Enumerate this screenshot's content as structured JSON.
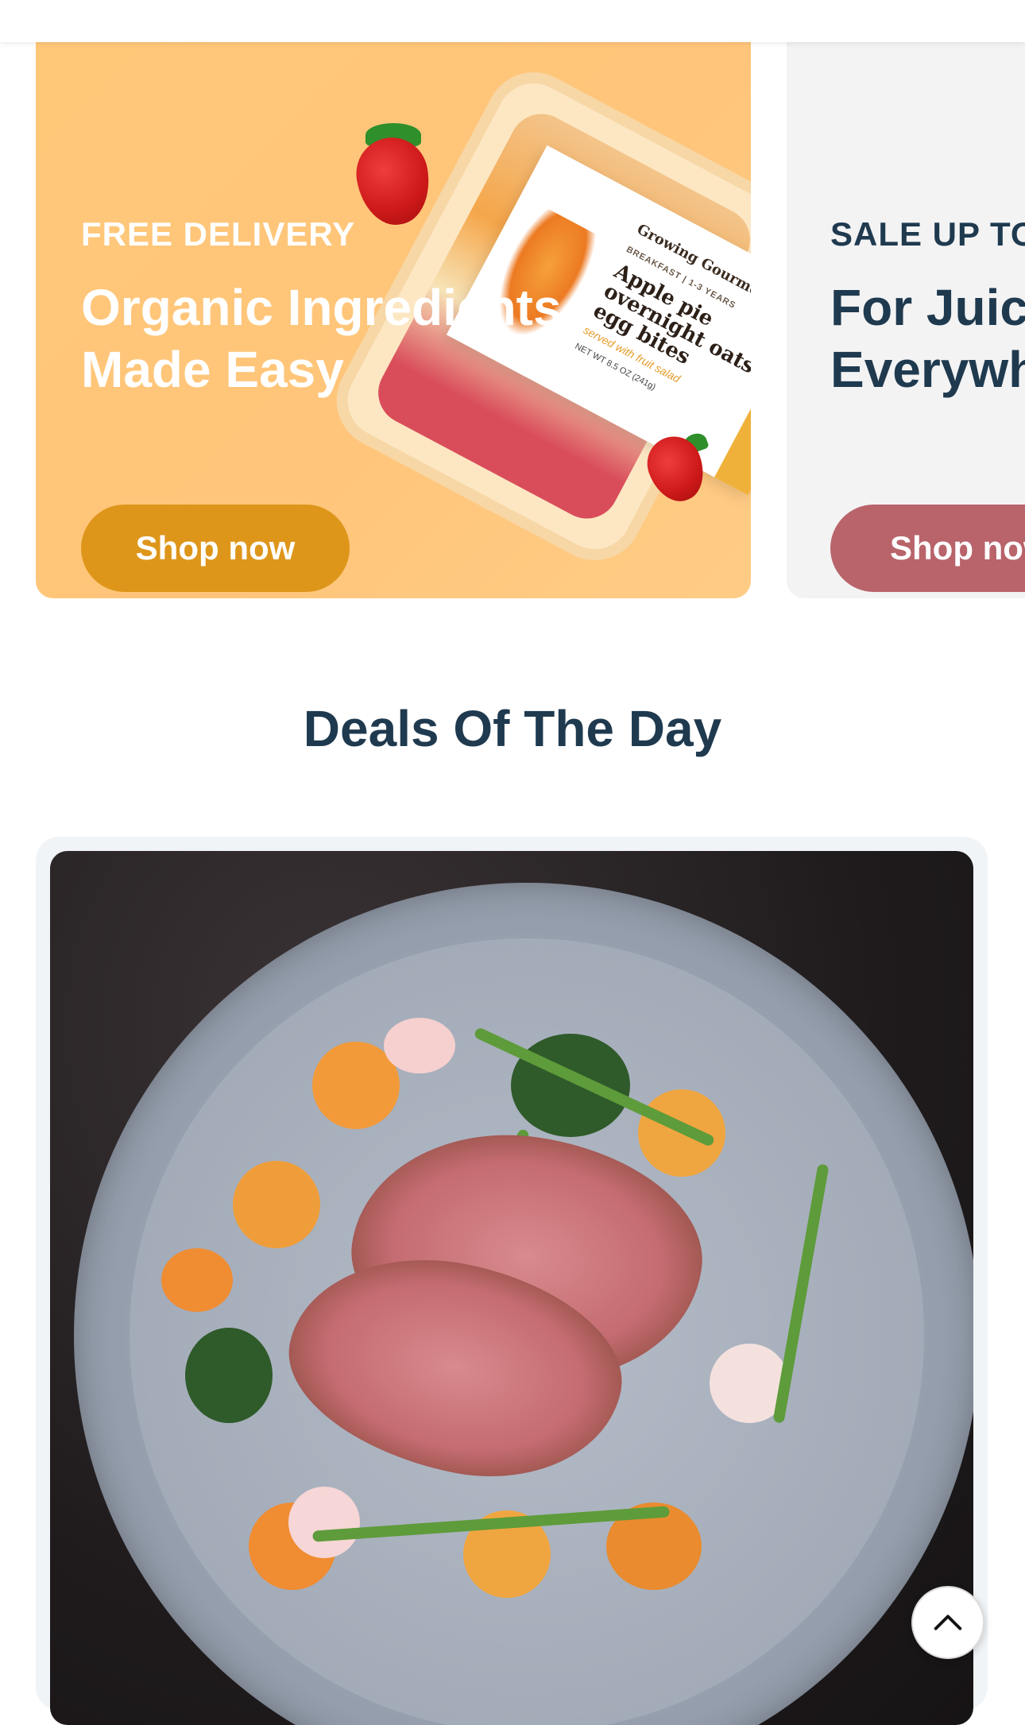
{
  "banners": [
    {
      "eyebrow": "FREE DELIVERY",
      "headline_line1": "Organic Ingredients",
      "headline_line2": "Made Easy",
      "button_label": "Shop now",
      "background": "#ffc879",
      "button_color": "#de961a"
    },
    {
      "eyebrow": "SALE UP TO",
      "headline_line1": "For Juic",
      "headline_line2": "Everywh",
      "button_label": "Shop now",
      "background": "#f3f3f4",
      "button_color": "#b8646a"
    }
  ],
  "product_package": {
    "brand": "Growing Gourmet",
    "label": "BREAKFAST | 1-3 YEARS",
    "title": "Apple pie overnight oats & egg bites",
    "subtitle": "served with fruit salad",
    "weight": "NET WT 8.5 OZ (241g)"
  },
  "deals": {
    "title": "Deals Of The Day"
  },
  "scroll_top": {
    "icon": "chevron-up-icon"
  },
  "colors": {
    "heading": "#1f3a4f",
    "white": "#ffffff"
  }
}
